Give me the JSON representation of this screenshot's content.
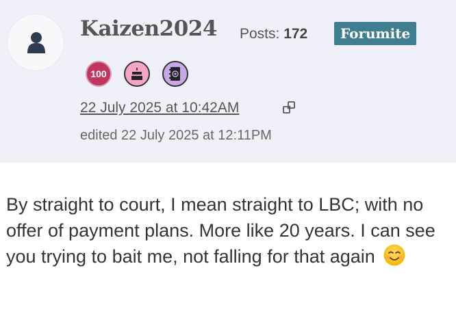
{
  "post": {
    "username": "Kaizen2024",
    "posts_label": "Posts:",
    "posts_count": "172",
    "rank": "Forumite",
    "badges": [
      {
        "icon": "badge-100-icon",
        "text": "100"
      },
      {
        "icon": "cake-badge-icon",
        "text": ""
      },
      {
        "icon": "address-book-badge-icon",
        "text": ""
      }
    ],
    "timestamp": "22 July 2025 at 10:42AM",
    "edited": "edited 22 July 2025 at 12:11PM",
    "body": "By straight to court, I mean straight to LBC; with no offer of payment plans. More like 20 years. I can see you trying to bait me, not falling for that again",
    "emoji": "smiling-face-emoji"
  },
  "colors": {
    "header_bg": "#f0f1f8",
    "rank_bg": "#3f7d90",
    "badge_100": "#c0375e",
    "badge_cake": "#f4a5c8",
    "badge_book": "#c9a8e8"
  }
}
